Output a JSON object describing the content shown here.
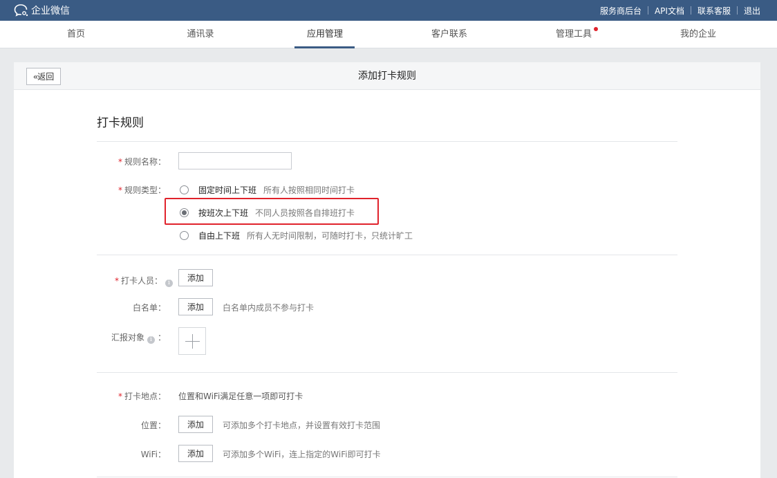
{
  "topbar": {
    "brand": "企业微信",
    "links": [
      "服务商后台",
      "API文档",
      "联系客服",
      "退出"
    ]
  },
  "nav": {
    "items": [
      "首页",
      "通讯录",
      "应用管理",
      "客户联系",
      "管理工具",
      "我的企业"
    ],
    "active": "应用管理"
  },
  "page": {
    "back_label": "返回",
    "title": "添加打卡规则",
    "section_title": "打卡规则"
  },
  "form": {
    "rule_name": {
      "label": "规则名称：",
      "value": ""
    },
    "rule_type": {
      "label": "规则类型：",
      "options": [
        {
          "label": "固定时间上下班",
          "desc": "所有人按照相同时间打卡",
          "checked": false
        },
        {
          "label": "按班次上下班",
          "desc": "不同人员按照各自排班打卡",
          "checked": true
        },
        {
          "label": "自由上下班",
          "desc": "所有人无时间限制，可随时打卡，只统计旷工",
          "checked": false
        }
      ]
    },
    "members": {
      "label": "打卡人员：",
      "button": "添加"
    },
    "whitelist": {
      "label": "白名单：",
      "button": "添加",
      "hint": "白名单内成员不参与打卡"
    },
    "report_to": {
      "label": "汇报对象",
      "colon": "："
    },
    "location": {
      "label": "打卡地点：",
      "hint": "位置和WiFi满足任意一项即可打卡"
    },
    "position": {
      "label": "位置：",
      "button": "添加",
      "hint": "可添加多个打卡地点，并设置有效打卡范围"
    },
    "wifi": {
      "label": "WiFi：",
      "button": "添加",
      "hint": "可添加多个WiFi，连上指定的WiFi即可打卡"
    }
  },
  "colors": {
    "topbar": "#3a5b84",
    "required": "#e0222b",
    "highlight_border": "#e0222b"
  },
  "icons": [
    "wechat-work-logo-icon",
    "double-chevron-left-icon",
    "info-icon",
    "plus-icon"
  ]
}
